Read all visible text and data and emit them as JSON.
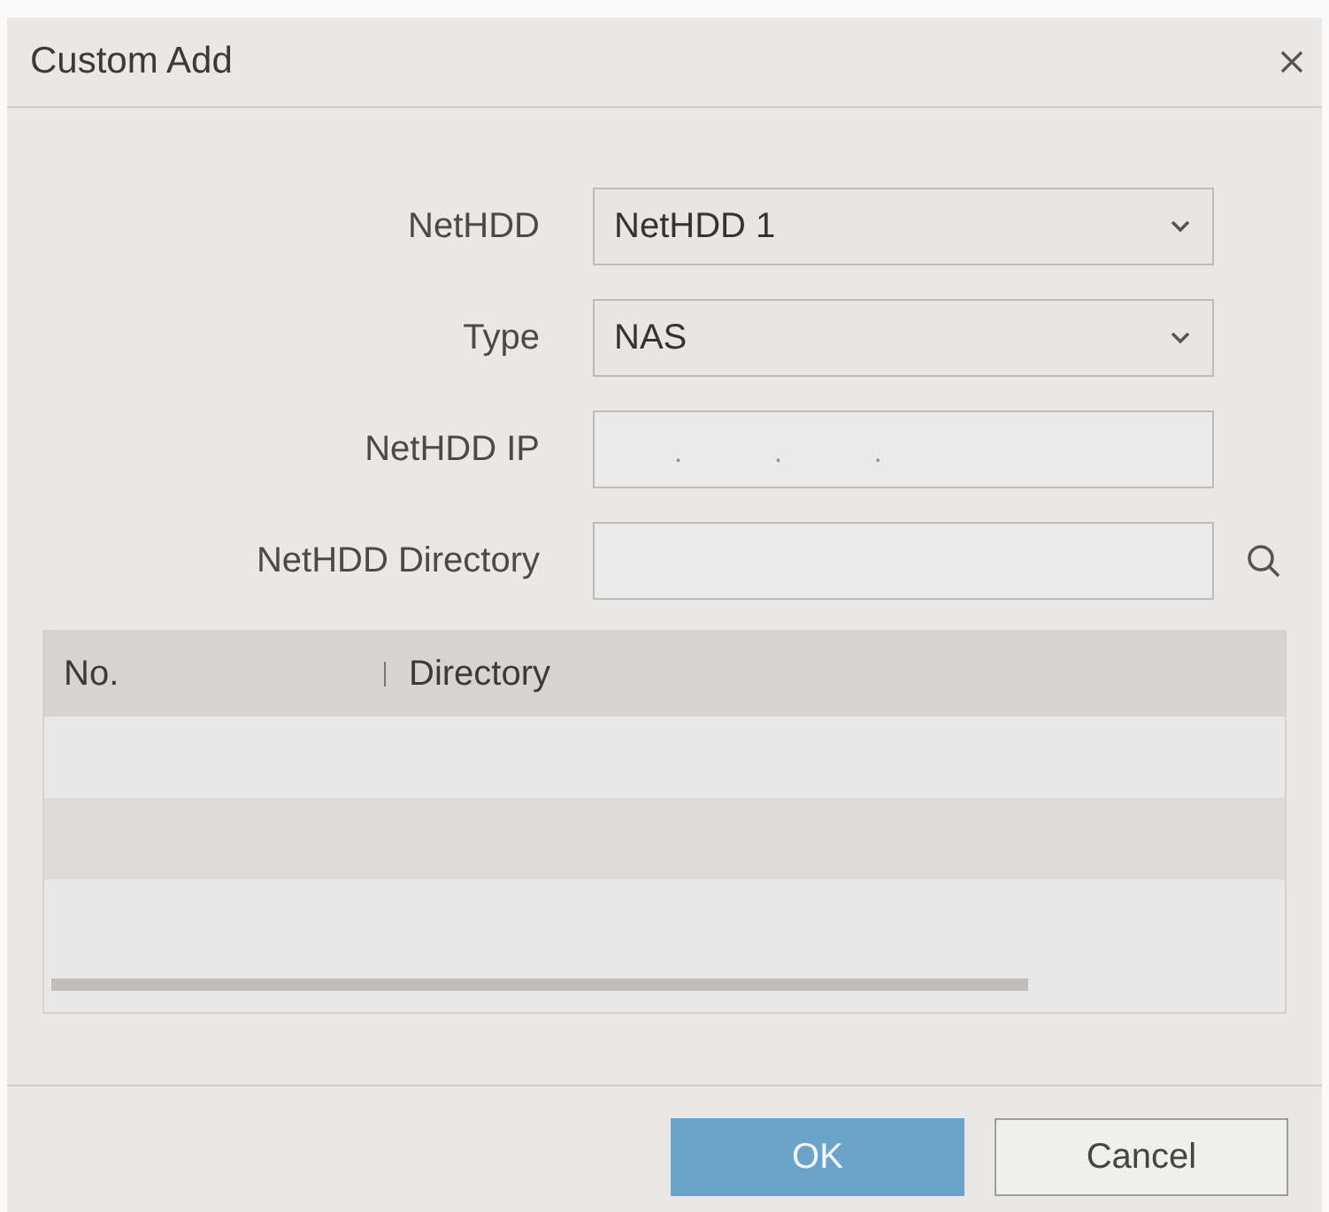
{
  "dialog": {
    "title": "Custom Add"
  },
  "fields": [
    {
      "label": "NetHDD",
      "kind": "select",
      "value": "NetHDD 1"
    },
    {
      "label": "Type",
      "kind": "select",
      "value": "NAS"
    },
    {
      "label": "NetHDD IP",
      "kind": "ip",
      "separators": [
        ".",
        ".",
        "."
      ]
    },
    {
      "label": "NetHDD Directory",
      "kind": "search"
    }
  ],
  "table": {
    "columns": [
      "No.",
      "Directory"
    ]
  },
  "buttons": [
    {
      "label": "OK",
      "kind": "primary",
      "disabled": true
    },
    {
      "label": "Cancel",
      "kind": "secondary",
      "disabled": false
    }
  ]
}
